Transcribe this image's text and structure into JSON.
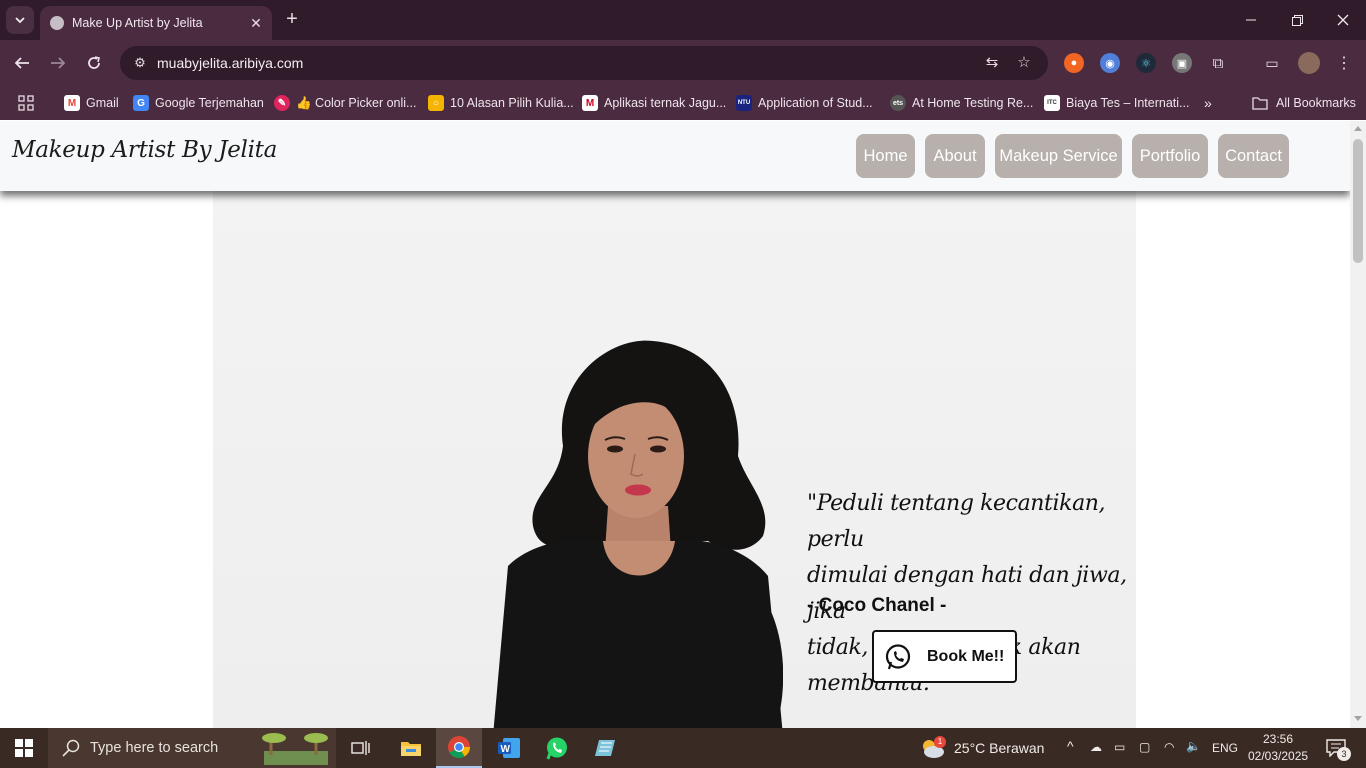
{
  "browser": {
    "tab_title": "Make Up Artist by Jelita",
    "url": "muabyjelita.aribiya.com",
    "bookmarks": [
      {
        "label": "Gmail",
        "icon": "gmail-icon",
        "color": "#ea4335"
      },
      {
        "label": "Google Terjemahan",
        "icon": "translate-icon",
        "color": "#4285f4"
      },
      {
        "label": "👍 Color Picker onli...",
        "icon": "color-picker-icon",
        "color": "#e0245e"
      },
      {
        "label": "10 Alasan Pilih Kulia...",
        "icon": "site-icon",
        "color": "#f4b400"
      },
      {
        "label": "Aplikasi ternak Jagu...",
        "icon": "m-logo-icon",
        "color": "#d0021b"
      },
      {
        "label": "Application of Stud...",
        "icon": "ntu-icon",
        "color": "#1a237e"
      },
      {
        "label": "At Home Testing Re...",
        "icon": "ets-icon",
        "color": "#555555"
      },
      {
        "label": "Biaya Tes – Internati...",
        "icon": "itc-icon",
        "color": "#777777"
      }
    ],
    "all_bookmarks": "All Bookmarks"
  },
  "site": {
    "brand": "Makeup Artist By Jelita",
    "nav": [
      "Home",
      "About",
      "Makeup Service",
      "Portfolio",
      "Contact"
    ],
    "quote_lines": [
      "\"Peduli tentang kecantikan, perlu",
      "dimulai dengan hati dan jiwa, jika",
      "tidak, makeup tidak akan membantu.\""
    ],
    "author": "- Coco Chanel -",
    "cta": "Book Me!!"
  },
  "taskbar": {
    "search_placeholder": "Type here to search",
    "weather": "25°C  Berawan",
    "weather_badge": "1",
    "language": "ENG",
    "time": "23:56",
    "date": "02/03/2025",
    "notifications": "3"
  },
  "colors": {
    "chrome_frame": "#2f1b29",
    "chrome_toolbar": "#4a2b40",
    "nav_button": "#b7b0ac",
    "header_bg": "#f7f8f9"
  }
}
